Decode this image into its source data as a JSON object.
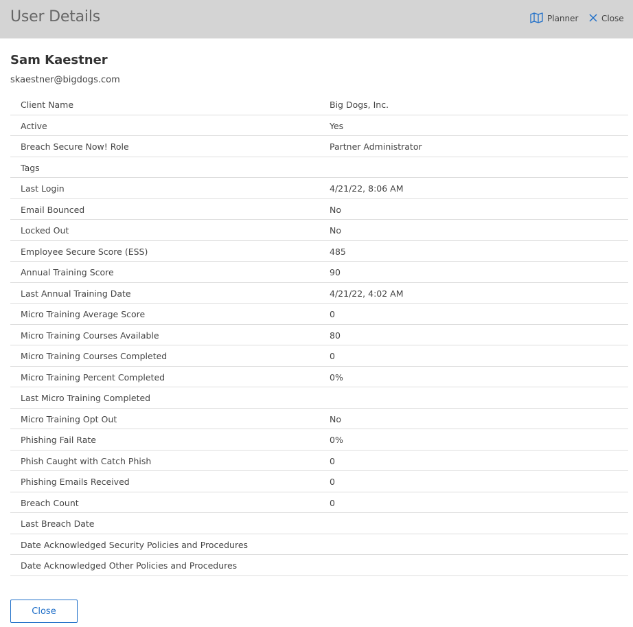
{
  "header": {
    "title": "User Details",
    "planner_label": "Planner",
    "close_label": "Close",
    "planner_icon": "map-icon",
    "close_icon": "close-icon",
    "accent_color": "#1e6ec8"
  },
  "user": {
    "name": "Sam Kaestner",
    "email": "skaestner@bigdogs.com"
  },
  "details": [
    {
      "label": "Client Name",
      "value": "Big Dogs, Inc."
    },
    {
      "label": "Active",
      "value": "Yes"
    },
    {
      "label": "Breach Secure Now! Role",
      "value": "Partner Administrator"
    },
    {
      "label": "Tags",
      "value": ""
    },
    {
      "label": "Last Login",
      "value": "4/21/22, 8:06 AM"
    },
    {
      "label": "Email Bounced",
      "value": "No"
    },
    {
      "label": "Locked Out",
      "value": "No"
    },
    {
      "label": "Employee Secure Score (ESS)",
      "value": "485"
    },
    {
      "label": "Annual Training Score",
      "value": "90"
    },
    {
      "label": "Last Annual Training Date",
      "value": "4/21/22, 4:02 AM"
    },
    {
      "label": "Micro Training Average Score",
      "value": "0"
    },
    {
      "label": "Micro Training Courses Available",
      "value": "80"
    },
    {
      "label": "Micro Training Courses Completed",
      "value": "0"
    },
    {
      "label": "Micro Training Percent Completed",
      "value": "0%"
    },
    {
      "label": "Last Micro Training Completed",
      "value": ""
    },
    {
      "label": "Micro Training Opt Out",
      "value": "No"
    },
    {
      "label": "Phishing Fail Rate",
      "value": "0%"
    },
    {
      "label": "Phish Caught with Catch Phish",
      "value": "0"
    },
    {
      "label": "Phishing Emails Received",
      "value": "0"
    },
    {
      "label": "Breach Count",
      "value": "0"
    },
    {
      "label": "Last Breach Date",
      "value": ""
    },
    {
      "label": "Date Acknowledged Security Policies and Procedures",
      "value": ""
    },
    {
      "label": "Date Acknowledged Other Policies and Procedures",
      "value": ""
    }
  ],
  "footer": {
    "close_button_label": "Close"
  }
}
